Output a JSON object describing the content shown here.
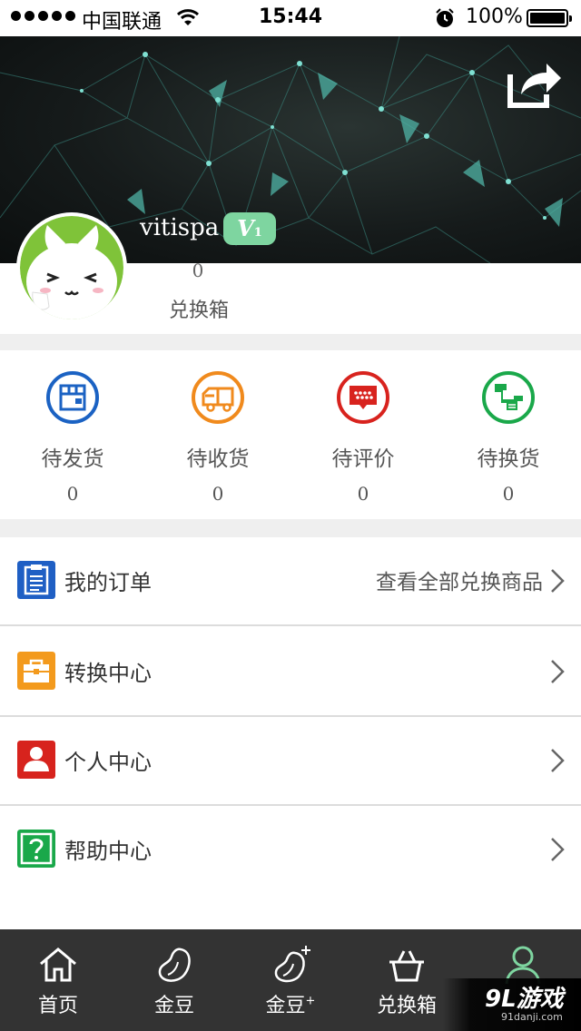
{
  "status_bar": {
    "carrier": "中国联通",
    "time": "15:44",
    "battery": "100%",
    "icons": [
      "signal-dots-icon",
      "wifi-icon",
      "alarm-icon",
      "battery-icon"
    ]
  },
  "header": {
    "username": "vitispa",
    "vip_level": "V",
    "vip_sub": "1",
    "box_count": "0",
    "box_label": "兑换箱",
    "share_icon": "share-icon"
  },
  "order_status": [
    {
      "label": "待发货",
      "count": "0",
      "icon": "box-icon",
      "color": "#1b62c3"
    },
    {
      "label": "待收货",
      "count": "0",
      "icon": "truck-icon",
      "color": "#f08a1d"
    },
    {
      "label": "待评价",
      "count": "0",
      "icon": "chat-bubble-icon",
      "color": "#d8231e"
    },
    {
      "label": "待换货",
      "count": "0",
      "icon": "exchange-icon",
      "color": "#1aa84a"
    }
  ],
  "menu": [
    {
      "label": "我的订单",
      "right_text": "查看全部兑换商品",
      "icon": "clipboard-icon",
      "color": "#1f5fc4"
    },
    {
      "label": "转换中心",
      "right_text": "",
      "icon": "toolbox-icon",
      "color": "#f39a1d"
    },
    {
      "label": "个人中心",
      "right_text": "",
      "icon": "person-icon",
      "color": "#d7231d"
    },
    {
      "label": "帮助中心",
      "right_text": "",
      "icon": "question-icon",
      "color": "#1aa84a"
    }
  ],
  "tabbar": {
    "tabs": [
      {
        "label": "首页",
        "icon": "home-icon"
      },
      {
        "label": "金豆",
        "icon": "bean-icon"
      },
      {
        "label": "金豆",
        "sup": "+",
        "icon": "bean-plus-icon"
      },
      {
        "label": "兑换箱",
        "icon": "basket-icon"
      },
      {
        "label": "",
        "icon": "person-outline-icon",
        "active": true,
        "active_color": "#7ed5a0"
      }
    ]
  },
  "watermark": {
    "main": "9L游戏",
    "sub": "91danji.com"
  }
}
